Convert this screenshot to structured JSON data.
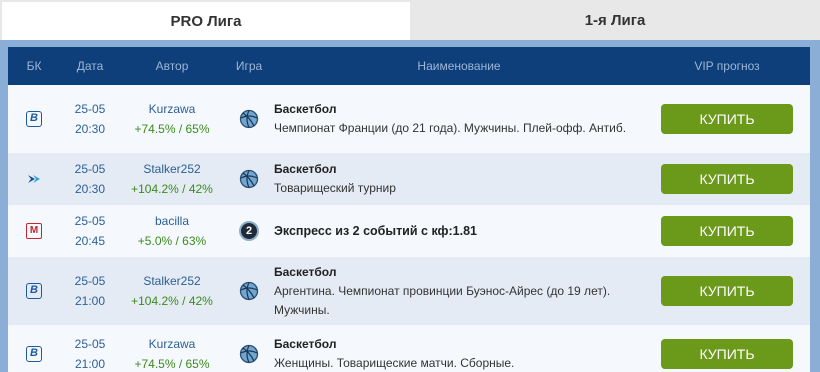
{
  "tabs": [
    {
      "label": "PRO Лига",
      "active": true
    },
    {
      "label": "1-я Лига",
      "active": false
    }
  ],
  "table": {
    "headers": [
      "БК",
      "Дата",
      "Автор",
      "Игра",
      "Наименование",
      "VIP прогноз"
    ],
    "rows": [
      {
        "bk": "bk-icon-b",
        "date": "25-05",
        "time": "20:30",
        "author": "Kurzawa",
        "stats": "+74.5% / 65%",
        "game": "basketball-icon",
        "title": "Баскетбол",
        "desc": "Чемпионат Франции (до 21 года). Мужчины. Плей-офф. Антиб.",
        "buy": "КУПИТЬ"
      },
      {
        "bk": "bk-icon-arrow",
        "date": "25-05",
        "time": "20:30",
        "author": "Stalker252",
        "stats": "+104.2% / 42%",
        "game": "basketball-icon",
        "title": "Баскетбол",
        "desc": "Товарищеский турнир",
        "buy": "КУПИТЬ"
      },
      {
        "bk": "bk-icon-m",
        "date": "25-05",
        "time": "20:45",
        "author": "bacilla",
        "stats": "+5.0% / 63%",
        "game": "2",
        "title": "Экспресс из 2 событий с кф:1.81",
        "desc": "",
        "buy": "КУПИТЬ"
      },
      {
        "bk": "bk-icon-b",
        "date": "25-05",
        "time": "21:00",
        "author": "Stalker252",
        "stats": "+104.2% / 42%",
        "game": "basketball-icon",
        "title": "Баскетбол",
        "desc": "Аргентина. Чемпионат провинции Буэнос-Айрес (до 19 лет). Мужчины.",
        "buy": "КУПИТЬ"
      },
      {
        "bk": "bk-icon-b",
        "date": "25-05",
        "time": "21:00",
        "author": "Kurzawa",
        "stats": "+74.5% / 65%",
        "game": "basketball-icon",
        "title": "Баскетбол",
        "desc": "Женщины. Товарищеские матчи. Сборные.",
        "buy": "КУПИТЬ"
      }
    ]
  },
  "colors": {
    "header_bg": "#0e3f7a",
    "buy_button": "#6b9a1a",
    "frame": "#8aaed6",
    "stats": "#3a8a1c"
  }
}
